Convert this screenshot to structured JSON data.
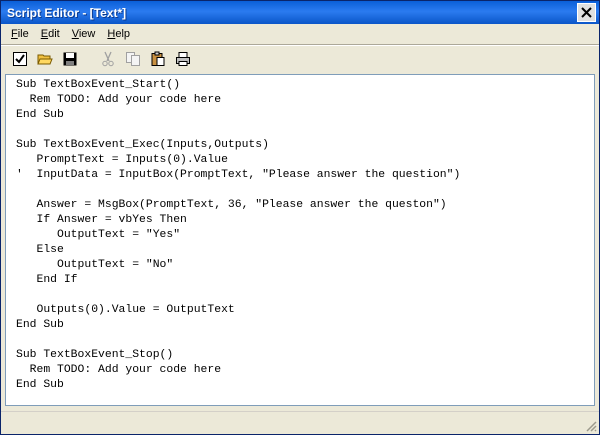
{
  "window": {
    "title": "Script Editor - [Text*]"
  },
  "menu": [
    {
      "key": "F",
      "rest": "ile"
    },
    {
      "key": "E",
      "rest": "dit"
    },
    {
      "key": "V",
      "rest": "iew"
    },
    {
      "key": "H",
      "rest": "elp"
    }
  ],
  "toolbar": {
    "icons": [
      "check-icon",
      "open-folder-icon",
      "save-icon",
      "cut-icon",
      "copy-icon",
      "paste-icon",
      "print-icon"
    ],
    "disabled": [
      "cut-icon",
      "copy-icon"
    ]
  },
  "editor": {
    "lines": [
      "Sub TextBoxEvent_Start()",
      "  Rem TODO: Add your code here",
      "End Sub",
      "",
      "Sub TextBoxEvent_Exec(Inputs,Outputs)",
      "   PromptText = Inputs(0).Value",
      "'  InputData = InputBox(PromptText, \"Please answer the question\")",
      "",
      "   Answer = MsgBox(PromptText, 36, \"Please answer the queston\")",
      "   If Answer = vbYes Then",
      "      OutputText = \"Yes\"",
      "   Else",
      "      OutputText = \"No\"",
      "   End If",
      "",
      "   Outputs(0).Value = OutputText",
      "End Sub",
      "",
      "Sub TextBoxEvent_Stop()",
      "  Rem TODO: Add your code here",
      "End Sub"
    ]
  },
  "colors": {
    "titlebar": "#0a5fd8",
    "chrome": "#ece9d8",
    "editor_border": "#7f9db9"
  }
}
